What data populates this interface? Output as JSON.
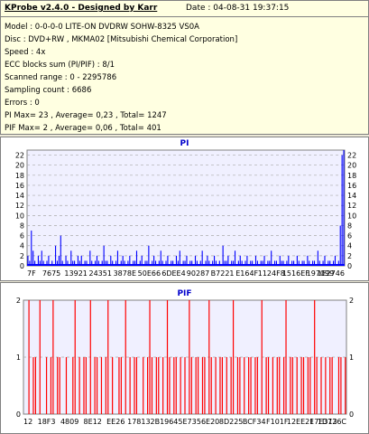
{
  "header": {
    "title": "KProbe v2.4.0 - Designed by Karr",
    "date": "Date : 04-08-31 19:37:15"
  },
  "info_lines": [
    "Model : 0-0-0-0 LITE-ON DVDRW SOHW-8325  VS0A",
    "Disc : DVD+RW , MKMA02 [Mitsubishi Chemical Corporation]",
    "Speed : 4x",
    "ECC blocks sum (PI/PIF) : 8/1",
    "Scanned range : 0 - 2295786",
    "Sampling count : 6686",
    "Errors : 0",
    "PI Max= 23 , Average= 0,23 , Total= 1247",
    "PIF Max= 2 , Average= 0,06 , Total= 401"
  ],
  "colors": {
    "pi_series": "#0000ff",
    "pif_series": "#ff0000",
    "plot_bg": "#f0f0ff",
    "grid": "#aaaaaa",
    "title": "#0000cc"
  },
  "chart_data": [
    {
      "type": "bar",
      "title": "PI",
      "x_tick_labels": [
        "7F",
        "7675",
        "13921",
        "24351",
        "3878E",
        "50E66",
        "6DEE4",
        "90287",
        "B7221",
        "E164F",
        "1124F8",
        "1516EF",
        "197099",
        "1E2746"
      ],
      "y_ticks": [
        0,
        2,
        4,
        6,
        8,
        10,
        12,
        14,
        16,
        18,
        20,
        22
      ],
      "ylim": [
        0,
        23
      ],
      "grid": true,
      "series": [
        {
          "values": [
            2,
            1,
            7,
            3,
            1,
            0,
            2,
            1,
            3,
            1,
            0,
            1,
            2,
            0,
            1,
            0,
            4,
            1,
            2,
            6,
            1,
            0,
            2,
            1,
            0,
            3,
            1,
            1,
            0,
            2,
            1,
            2,
            0,
            1,
            1,
            0,
            3,
            1,
            0,
            1,
            2,
            1,
            0,
            1,
            4,
            1,
            1,
            0,
            2,
            1,
            0,
            1,
            3,
            0,
            1,
            2,
            1,
            0,
            1,
            2,
            0,
            1,
            1,
            3,
            0,
            1,
            2,
            0,
            1,
            1,
            4,
            0,
            1,
            2,
            1,
            0,
            1,
            3,
            1,
            0,
            1,
            2,
            0,
            1,
            1,
            0,
            2,
            1,
            3,
            0,
            1,
            1,
            2,
            0,
            1,
            1,
            0,
            2,
            1,
            0,
            1,
            3,
            0,
            1,
            2,
            1,
            0,
            1,
            2,
            1,
            0,
            1,
            0,
            4,
            1,
            1,
            2,
            0,
            1,
            1,
            3,
            0,
            1,
            2,
            1,
            0,
            1,
            2,
            0,
            1,
            1,
            0,
            2,
            1,
            0,
            1,
            1,
            2,
            0,
            1,
            1,
            3,
            0,
            1,
            1,
            0,
            2,
            1,
            1,
            0,
            1,
            2,
            0,
            1,
            1,
            0,
            2,
            1,
            0,
            1,
            1,
            0,
            2,
            1,
            0,
            1,
            1,
            0,
            3,
            1,
            0,
            1,
            2,
            0,
            1,
            1,
            0,
            1,
            2,
            0,
            1,
            8,
            22,
            23
          ]
        }
      ]
    },
    {
      "type": "bar",
      "title": "PIF",
      "x_tick_labels": [
        "12",
        "18F3",
        "4809",
        "8E12",
        "EE26",
        "17813",
        "2B196",
        "45E73",
        "56E20",
        "8D225",
        "BCF34",
        "F101F",
        "12EE2F",
        "17E313",
        "1D726C"
      ],
      "y_ticks": [
        0,
        1,
        2
      ],
      "ylim": [
        0,
        2
      ],
      "grid": true,
      "series": [
        {
          "values": [
            0,
            0,
            2,
            0,
            1,
            1,
            0,
            2,
            0,
            0,
            1,
            0,
            1,
            2,
            0,
            1,
            1,
            0,
            0,
            1,
            0,
            0,
            1,
            2,
            0,
            1,
            0,
            1,
            1,
            0,
            2,
            0,
            1,
            1,
            0,
            1,
            0,
            1,
            2,
            0,
            1,
            0,
            0,
            1,
            1,
            0,
            2,
            0,
            1,
            0,
            1,
            1,
            0,
            0,
            1,
            0,
            1,
            2,
            1,
            0,
            1,
            1,
            0,
            1,
            0,
            2,
            1,
            0,
            1,
            1,
            0,
            1,
            0,
            1,
            0,
            2,
            1,
            0,
            1,
            1,
            0,
            1,
            1,
            0,
            2,
            1,
            0,
            1,
            0,
            1,
            1,
            0,
            1,
            0,
            1,
            2,
            0,
            1,
            1,
            0,
            1,
            0,
            1,
            1,
            0,
            1,
            1,
            0,
            2,
            0,
            1,
            1,
            0,
            1,
            0,
            1,
            1,
            0,
            1,
            2,
            0,
            1,
            1,
            0,
            1,
            0,
            1,
            1,
            0,
            1,
            1,
            0,
            2,
            1,
            0,
            1,
            0,
            1,
            0,
            1,
            1,
            0,
            0,
            1,
            1,
            0,
            1
          ]
        }
      ]
    }
  ]
}
